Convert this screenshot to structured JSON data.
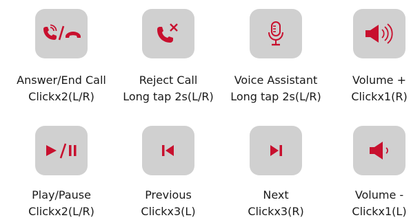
{
  "accent_color": "#c8102e",
  "tile_color": "#d0d0d0",
  "controls": [
    {
      "id": "answer-end-call",
      "icon": "phone-answer-end-icon",
      "name": "Answer/End Call",
      "gesture": "Clickx2(L/R)"
    },
    {
      "id": "reject-call",
      "icon": "phone-reject-icon",
      "name": "Reject Call",
      "gesture": "Long tap 2s(L/R)"
    },
    {
      "id": "voice-assistant",
      "icon": "microphone-icon",
      "name": "Voice Assistant",
      "gesture": "Long tap 2s(L/R)"
    },
    {
      "id": "volume-up",
      "icon": "volume-up-icon",
      "name": "Volume +",
      "gesture": "Clickx1(R)"
    },
    {
      "id": "play-pause",
      "icon": "play-pause-icon",
      "name": "Play/Pause",
      "gesture": "Clickx2(L/R)"
    },
    {
      "id": "previous",
      "icon": "previous-track-icon",
      "name": "Previous",
      "gesture": "Clickx3(L)"
    },
    {
      "id": "next",
      "icon": "next-track-icon",
      "name": "Next",
      "gesture": "Clickx3(R)"
    },
    {
      "id": "volume-down",
      "icon": "volume-down-icon",
      "name": "Volume -",
      "gesture": "Clickx1(L)"
    }
  ]
}
